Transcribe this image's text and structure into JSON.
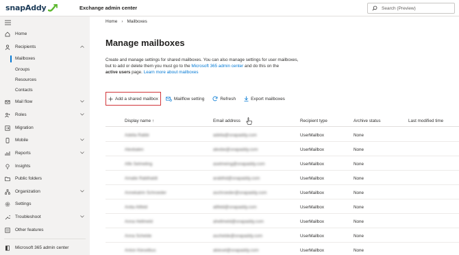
{
  "header": {
    "brand": "snapAddy",
    "app_title": "Exchange admin center",
    "search_placeholder": "Search (Preview)"
  },
  "sidebar": {
    "items": [
      {
        "label": "Home",
        "icon": "home-icon",
        "expandable": false
      },
      {
        "label": "Recipients",
        "icon": "person-icon",
        "expandable": true
      },
      {
        "label": "Mailboxes",
        "icon": "",
        "expandable": false,
        "sub": true,
        "active": true
      },
      {
        "label": "Groups",
        "icon": "",
        "expandable": false,
        "sub": true
      },
      {
        "label": "Resources",
        "icon": "",
        "expandable": false,
        "sub": true
      },
      {
        "label": "Contacts",
        "icon": "",
        "expandable": false,
        "sub": true
      },
      {
        "label": "Mail flow",
        "icon": "mail-flow-icon",
        "expandable": true
      },
      {
        "label": "Roles",
        "icon": "roles-icon",
        "expandable": true
      },
      {
        "label": "Migration",
        "icon": "migration-icon",
        "expandable": false
      },
      {
        "label": "Mobile",
        "icon": "mobile-icon",
        "expandable": true
      },
      {
        "label": "Reports",
        "icon": "reports-icon",
        "expandable": true
      },
      {
        "label": "Insights",
        "icon": "insights-icon",
        "expandable": false
      },
      {
        "label": "Public folders",
        "icon": "folder-icon",
        "expandable": false
      },
      {
        "label": "Organization",
        "icon": "organization-icon",
        "expandable": true
      },
      {
        "label": "Settings",
        "icon": "gear-icon",
        "expandable": false
      },
      {
        "label": "Troubleshoot",
        "icon": "troubleshoot-icon",
        "expandable": true
      },
      {
        "label": "Other features",
        "icon": "other-features-icon",
        "expandable": false
      }
    ],
    "footer": "Microsoft 365 admin center"
  },
  "breadcrumb": {
    "home": "Home",
    "current": "Mailboxes"
  },
  "page": {
    "title": "Manage mailboxes",
    "desc_1": "Create and manage settings for shared mailboxes. You can also manage settings for user mailboxes,",
    "desc_2a": "but to add or delete them you must go to the ",
    "desc_link1": "Microsoft 365 admin center",
    "desc_2b": " and do this on the",
    "desc_3a": "active users",
    "desc_3b": " page. ",
    "desc_link2": "Learn more about mailboxes"
  },
  "toolbar": {
    "add_shared": "Add a shared mailbox",
    "mailflow": "Mailflow setting",
    "refresh": "Refresh",
    "export": "Export mailboxes"
  },
  "table": {
    "columns": {
      "display_name": "Display name ↑",
      "email": "Email address",
      "recipient_type": "Recipient type",
      "archive_status": "Archive status",
      "last_modified": "Last modified time"
    },
    "rows": [
      {
        "name": "Adelia Rabbi",
        "email": "adelia@snapaddy.com",
        "type": "UserMailbox",
        "archive": "None"
      },
      {
        "name": "Alexbalen",
        "email": "alexbe@snapaddy.com",
        "type": "UserMailbox",
        "archive": "None"
      },
      {
        "name": "Alfe Selmeling",
        "email": "aselmeing@snapaddy.com",
        "type": "UserMailbox",
        "archive": "None"
      },
      {
        "name": "Amalie Rabthaldt",
        "email": "arabthd@snapaddy.com",
        "type": "UserMailbox",
        "archive": "None"
      },
      {
        "name": "Annekatrin Schroeder",
        "email": "aschroeder@snapaddy.com",
        "type": "UserMailbox",
        "archive": "None"
      },
      {
        "name": "Anita Altfeld",
        "email": "altfeld@snapaddy.com",
        "type": "UserMailbox",
        "archive": "None"
      },
      {
        "name": "Anna Hellmeld",
        "email": "ahellmeld@snapaddy.com",
        "type": "UserMailbox",
        "archive": "None"
      },
      {
        "name": "Anna Schelde",
        "email": "aschelde@snapaddy.com",
        "type": "UserMailbox",
        "archive": "None"
      },
      {
        "name": "Anton Kieselbus",
        "email": "akiesel@snapaddy.com",
        "type": "UserMailbox",
        "archive": "None"
      }
    ]
  },
  "colors": {
    "accent": "#0078d4",
    "highlight": "#d13438",
    "sidebar_bg": "#f3f2f1",
    "brand_green": "#5cb82e"
  }
}
